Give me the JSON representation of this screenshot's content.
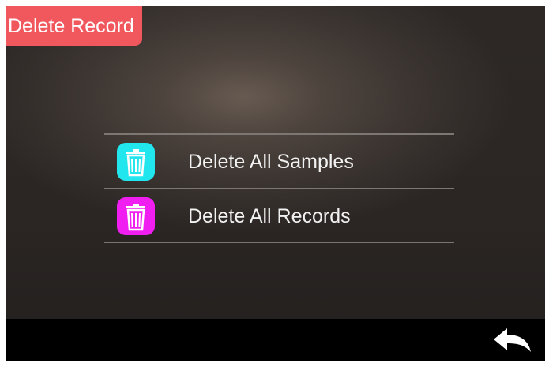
{
  "header": {
    "title": "Delete Record"
  },
  "menu": {
    "items": [
      {
        "label": "Delete All Samples",
        "icon": "trash-icon",
        "icon_color": "#22e6ee"
      },
      {
        "label": "Delete All Records",
        "icon": "trash-icon",
        "icon_color": "#f01ef0"
      }
    ]
  },
  "footer": {
    "back_icon": "back-arrow-icon"
  },
  "colors": {
    "title_tab": "#f0585d",
    "background": "#2e2927",
    "bottom_bar": "#000000"
  }
}
